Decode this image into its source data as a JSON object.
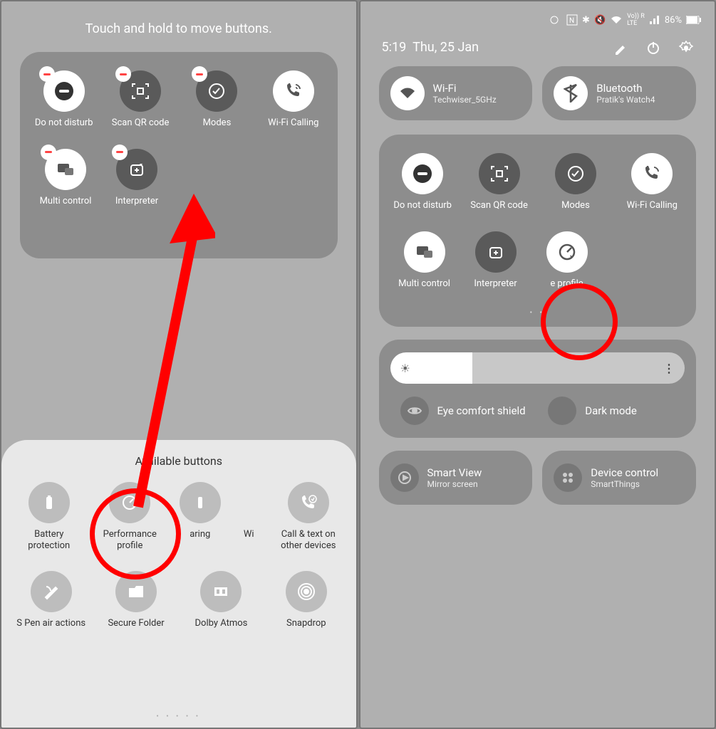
{
  "left": {
    "header": "Touch and hold to move buttons.",
    "tiles": [
      {
        "label": "Do not disturb"
      },
      {
        "label": "Scan QR code"
      },
      {
        "label": "Modes"
      },
      {
        "label": "Wi-Fi Calling"
      },
      {
        "label": "Multi control"
      },
      {
        "label": "Interpreter"
      }
    ],
    "available_title": "Available buttons",
    "available": [
      {
        "label": "Battery protection"
      },
      {
        "label": "Performance profile"
      },
      {
        "label": "aring"
      },
      {
        "label": "Wi"
      },
      {
        "label": "Call & text on other devices"
      },
      {
        "label": "S Pen air actions"
      },
      {
        "label": "Secure Folder"
      },
      {
        "label": "Dolby Atmos"
      },
      {
        "label": "Snapdrop"
      }
    ]
  },
  "right": {
    "battery": "86%",
    "time": "5:19",
    "date": "Thu, 25 Jan",
    "wifi": {
      "title": "Wi-Fi",
      "sub": "Techwiser_5GHz"
    },
    "bt": {
      "title": "Bluetooth",
      "sub": "Pratik's Watch4"
    },
    "tiles": [
      {
        "label": "Do not disturb"
      },
      {
        "label": "Scan QR code"
      },
      {
        "label": "Modes"
      },
      {
        "label": "Wi-Fi Calling"
      },
      {
        "label": "Multi control"
      },
      {
        "label": "Interpreter"
      },
      {
        "label": "e profile"
      }
    ],
    "eye": "Eye comfort shield",
    "dark": "Dark mode",
    "smartview": {
      "title": "Smart View",
      "sub": "Mirror screen"
    },
    "devctrl": {
      "title": "Device control",
      "sub": "SmartThings"
    }
  }
}
